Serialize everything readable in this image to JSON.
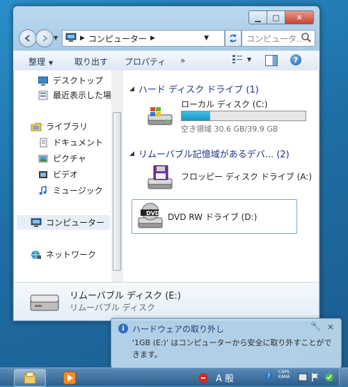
{
  "window": {
    "caption_buttons": {
      "minimize": "▁",
      "maximize": "□",
      "close": "✕"
    }
  },
  "address": {
    "path": "コンピューター",
    "separator": "▶",
    "refresh_icon": "refresh-icon"
  },
  "search": {
    "placeholder": "コンピュータ..."
  },
  "toolbar": {
    "organize": "整理",
    "eject": "取り出す",
    "properties": "プロパティ",
    "more": "»"
  },
  "nav": {
    "items": [
      {
        "label": "デスクトップ",
        "icon": "desktop-icon"
      },
      {
        "label": "最近表示した場所",
        "icon": "recent-places-icon"
      },
      {
        "label": "ライブラリ",
        "icon": "libraries-icon"
      },
      {
        "label": "ドキュメント",
        "icon": "documents-icon"
      },
      {
        "label": "ピクチャ",
        "icon": "pictures-icon"
      },
      {
        "label": "ビデオ",
        "icon": "videos-icon"
      },
      {
        "label": "ミュージック",
        "icon": "music-icon"
      },
      {
        "label": "コンピューター",
        "icon": "computer-icon"
      },
      {
        "label": "ネットワーク",
        "icon": "network-icon"
      }
    ],
    "selected": "コンピューター"
  },
  "groups": {
    "hdd": {
      "title": "ハード ディスク ドライブ (1)"
    },
    "removable": {
      "title": "リムーバブル記憶域があるデバ... (2)"
    }
  },
  "drives": {
    "local": {
      "name": "ローカル ディスク (C:)",
      "free_text": "空き領域 30.6 GB/39.9 GB",
      "used_fraction": 0.233
    },
    "floppy": {
      "name": "フロッピー ディスク ドライブ (A:)"
    },
    "dvd": {
      "name": "DVD RW ドライブ (D:)",
      "badge": "DVD"
    }
  },
  "details": {
    "title": "リムーバブル ディスク (E:)",
    "subtitle": "リムーバブル ディスク"
  },
  "balloon": {
    "title": "ハードウェアの取り外し",
    "message": "'1GB (E:)' はコンピューターから安全に取り外すことができます。",
    "info_icon": "i",
    "close": "✕"
  },
  "tray": {
    "ime": "A 般",
    "caps": "CAPS",
    "kana": "KANA",
    "help": "?"
  },
  "colors": {
    "accent": "#1e3287",
    "bar_fill": "#26a7d4",
    "selection": "#e6eef6"
  }
}
